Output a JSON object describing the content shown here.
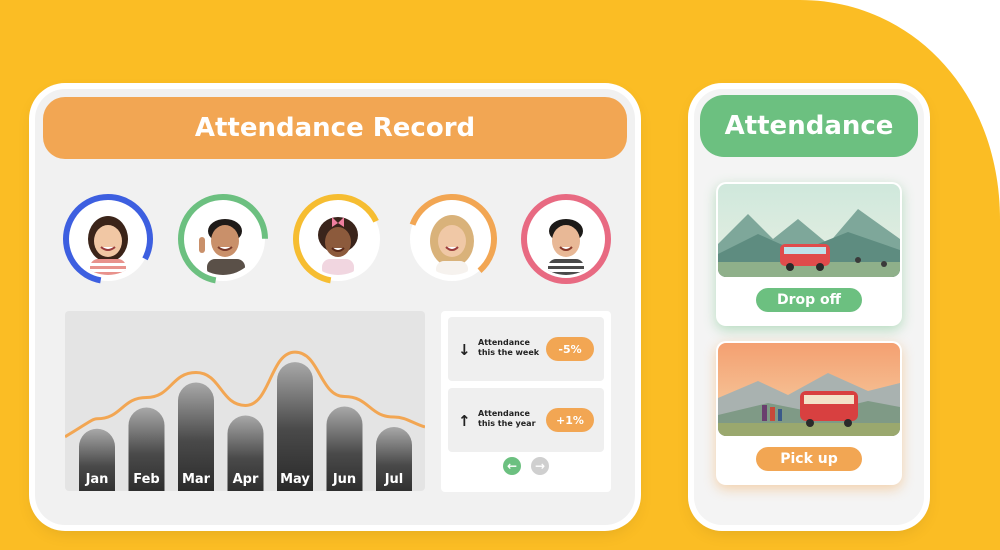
{
  "dashboard": {
    "title": "Attendance Record",
    "students": [
      {
        "name": "student-1",
        "ring_color": "#3d5fe0",
        "progress": 0.8
      },
      {
        "name": "student-2",
        "ring_color": "#6cc080",
        "progress": 0.72
      },
      {
        "name": "student-3",
        "ring_color": "#f6bd31",
        "progress": 0.65
      },
      {
        "name": "student-4",
        "ring_color": "#f2a653",
        "progress": 0.58
      },
      {
        "name": "student-5",
        "ring_color": "#e86a82",
        "progress": 1.0
      }
    ],
    "stats": [
      {
        "arrow": "↓",
        "label_line1": "Attendance",
        "label_line2": "this the week",
        "value": "-5%"
      },
      {
        "arrow": "↑",
        "label_line1": "Attendance",
        "label_line2": "this the year",
        "value": "+1%"
      }
    ],
    "nav": {
      "prev_icon": "arrow-left-icon",
      "next_icon": "arrow-right-icon"
    }
  },
  "chart_data": {
    "type": "bar",
    "categories": [
      "Jan",
      "Feb",
      "Mar",
      "Apr",
      "May",
      "Jun",
      "Jul"
    ],
    "values": [
      70,
      94,
      122,
      85,
      145,
      95,
      72
    ],
    "ylim": [
      0,
      180
    ],
    "grid": false
  },
  "phone": {
    "title": "Attendance",
    "dropoff_label": "Drop off",
    "pickup_label": "Pick up"
  },
  "colors": {
    "background_accent": "#fbbd24",
    "orange": "#f2a653",
    "green": "#6cc080",
    "bar_dark": "#3a3a3a"
  }
}
